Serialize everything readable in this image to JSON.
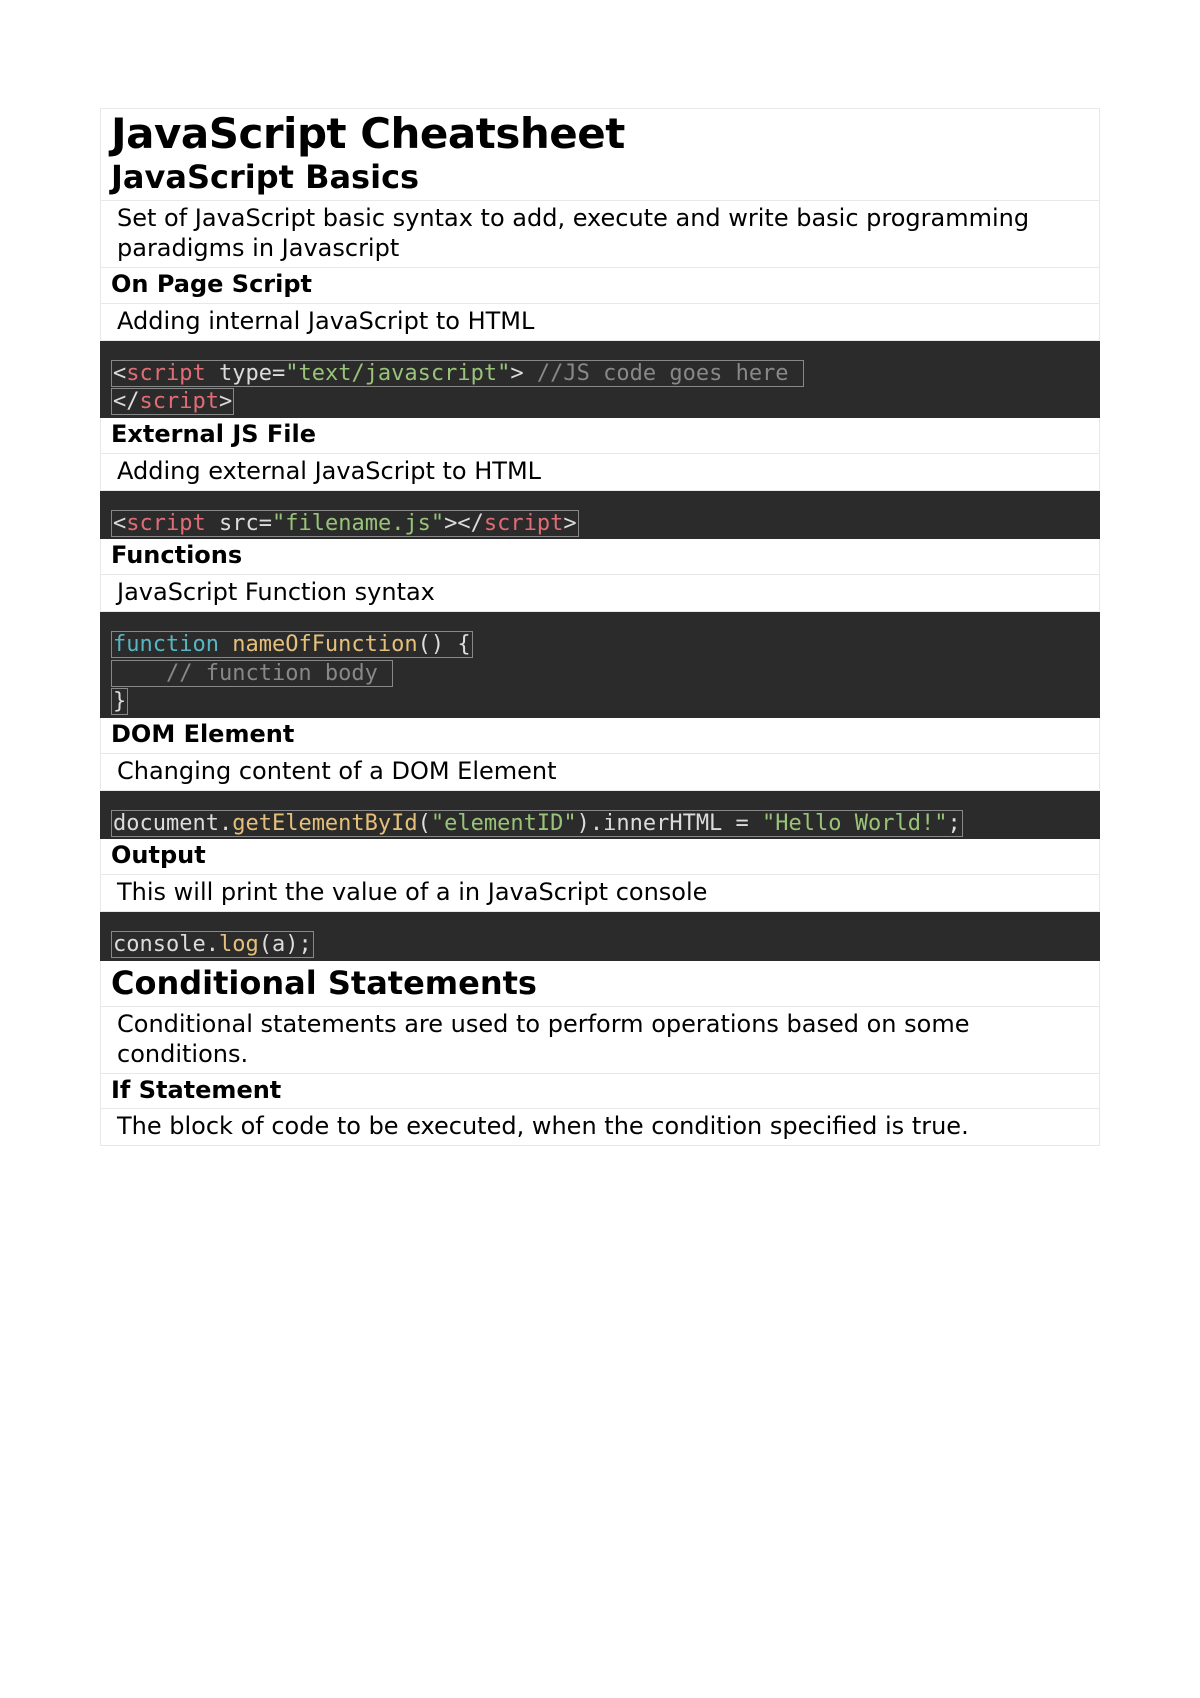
{
  "title": "JavaScript Cheatsheet",
  "sections": [
    {
      "heading": "JavaScript Basics",
      "desc": "Set of JavaScript basic syntax to add, execute and write basic programming paradigms in Javascript",
      "items": [
        {
          "title": "On Page Script",
          "desc": "Adding internal JavaScript to HTML",
          "code": [
            {
              "t": "<",
              "c": "punc"
            },
            {
              "t": "script",
              "c": "tag"
            },
            {
              "t": " ",
              "c": "punc"
            },
            {
              "t": "type",
              "c": "attr"
            },
            {
              "t": "=",
              "c": "punc"
            },
            {
              "t": "\"text/javascript\"",
              "c": "str"
            },
            {
              "t": "> ",
              "c": "punc"
            },
            {
              "t": "//JS code goes here ",
              "c": "cmt"
            },
            {
              "t": "\n",
              "c": "punc"
            },
            {
              "t": "</",
              "c": "punc"
            },
            {
              "t": "script",
              "c": "tag"
            },
            {
              "t": ">",
              "c": "punc"
            }
          ]
        },
        {
          "title": "External JS File",
          "desc": "Adding external JavaScript to HTML",
          "code": [
            {
              "t": "<",
              "c": "punc"
            },
            {
              "t": "script",
              "c": "tag"
            },
            {
              "t": " ",
              "c": "punc"
            },
            {
              "t": "src",
              "c": "attr"
            },
            {
              "t": "=",
              "c": "punc"
            },
            {
              "t": "\"filename.js\"",
              "c": "str"
            },
            {
              "t": "></",
              "c": "punc"
            },
            {
              "t": "script",
              "c": "tag"
            },
            {
              "t": ">",
              "c": "punc"
            }
          ]
        },
        {
          "title": "Functions",
          "desc": "JavaScript Function syntax",
          "code": [
            {
              "t": "function",
              "c": "kw"
            },
            {
              "t": " ",
              "c": "punc"
            },
            {
              "t": "nameOfFunction",
              "c": "fn"
            },
            {
              "t": "() {",
              "c": "punc"
            },
            {
              "t": "\n    ",
              "c": "punc"
            },
            {
              "t": "// function body ",
              "c": "cmt"
            },
            {
              "t": "\n",
              "c": "punc"
            },
            {
              "t": "}",
              "c": "punc"
            }
          ]
        },
        {
          "title": "DOM Element",
          "desc": "Changing content of a DOM Element",
          "code": [
            {
              "t": "document.",
              "c": "punc"
            },
            {
              "t": "getElementById",
              "c": "fn"
            },
            {
              "t": "(",
              "c": "punc"
            },
            {
              "t": "\"elementID\"",
              "c": "str"
            },
            {
              "t": ").innerHTML = ",
              "c": "punc"
            },
            {
              "t": "\"Hello World!\"",
              "c": "str"
            },
            {
              "t": ";",
              "c": "punc"
            }
          ]
        },
        {
          "title": "Output",
          "desc": "This will print the value of a in JavaScript console",
          "code": [
            {
              "t": "console.",
              "c": "punc"
            },
            {
              "t": "log",
              "c": "fn"
            },
            {
              "t": "(a);",
              "c": "punc"
            }
          ]
        }
      ]
    },
    {
      "heading": "Conditional Statements",
      "desc": "Conditional statements are used to perform operations based on some conditions.",
      "items": [
        {
          "title": "If Statement",
          "desc": "The block of code to be executed, when the condition specified is true."
        }
      ]
    }
  ]
}
